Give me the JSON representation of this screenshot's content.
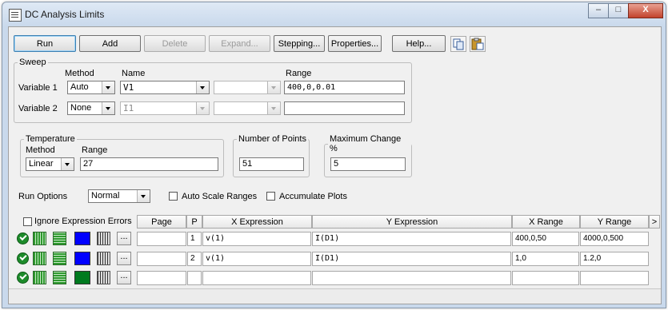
{
  "window": {
    "title": "DC Analysis Limits",
    "minimize": "–",
    "maximize": "□",
    "close": "X"
  },
  "toolbar": {
    "run": "Run",
    "add": "Add",
    "delete": "Delete",
    "expand": "Expand...",
    "stepping": "Stepping...",
    "properties": "Properties...",
    "help": "Help..."
  },
  "sweep": {
    "legend": "Sweep",
    "method_header": "Method",
    "name_header": "Name",
    "range_header": "Range",
    "var1": {
      "label": "Variable 1",
      "method": "Auto",
      "name": "V1",
      "range": "400,0,0.01"
    },
    "var2": {
      "label": "Variable 2",
      "method": "None",
      "name": "I1",
      "range": ""
    }
  },
  "temperature": {
    "legend": "Temperature",
    "method_label": "Method",
    "range_label": "Range",
    "method": "Linear",
    "range": "27"
  },
  "points": {
    "legend": "Number of Points",
    "value": "51"
  },
  "maxchange": {
    "legend": "Maximum Change %",
    "value": "5"
  },
  "run_options": {
    "label": "Run Options",
    "value": "Normal",
    "auto_scale": "Auto Scale Ranges",
    "accumulate": "Accumulate Plots"
  },
  "grid": {
    "headers": {
      "ignore": "Ignore Expression Errors",
      "page": "Page",
      "p": "P",
      "x_expr": "X Expression",
      "y_expr": "Y Expression",
      "x_range": "X Range",
      "y_range": "Y Range",
      "more": ">"
    },
    "rows": [
      {
        "page": "",
        "p": "1",
        "x_expr": "v(1)",
        "y_expr": "I(D1)",
        "x_range": "400,0,50",
        "y_range": "4000,0,500",
        "color": "#0000ff",
        "more": "..."
      },
      {
        "page": "",
        "p": "2",
        "x_expr": "v(1)",
        "y_expr": "I(D1)",
        "x_range": "1,0",
        "y_range": "1.2,0",
        "color": "#0000ff",
        "more": "..."
      },
      {
        "page": "",
        "p": "",
        "x_expr": "",
        "y_expr": "",
        "x_range": "",
        "y_range": "",
        "color": "#007a1f",
        "more": "..."
      }
    ]
  }
}
